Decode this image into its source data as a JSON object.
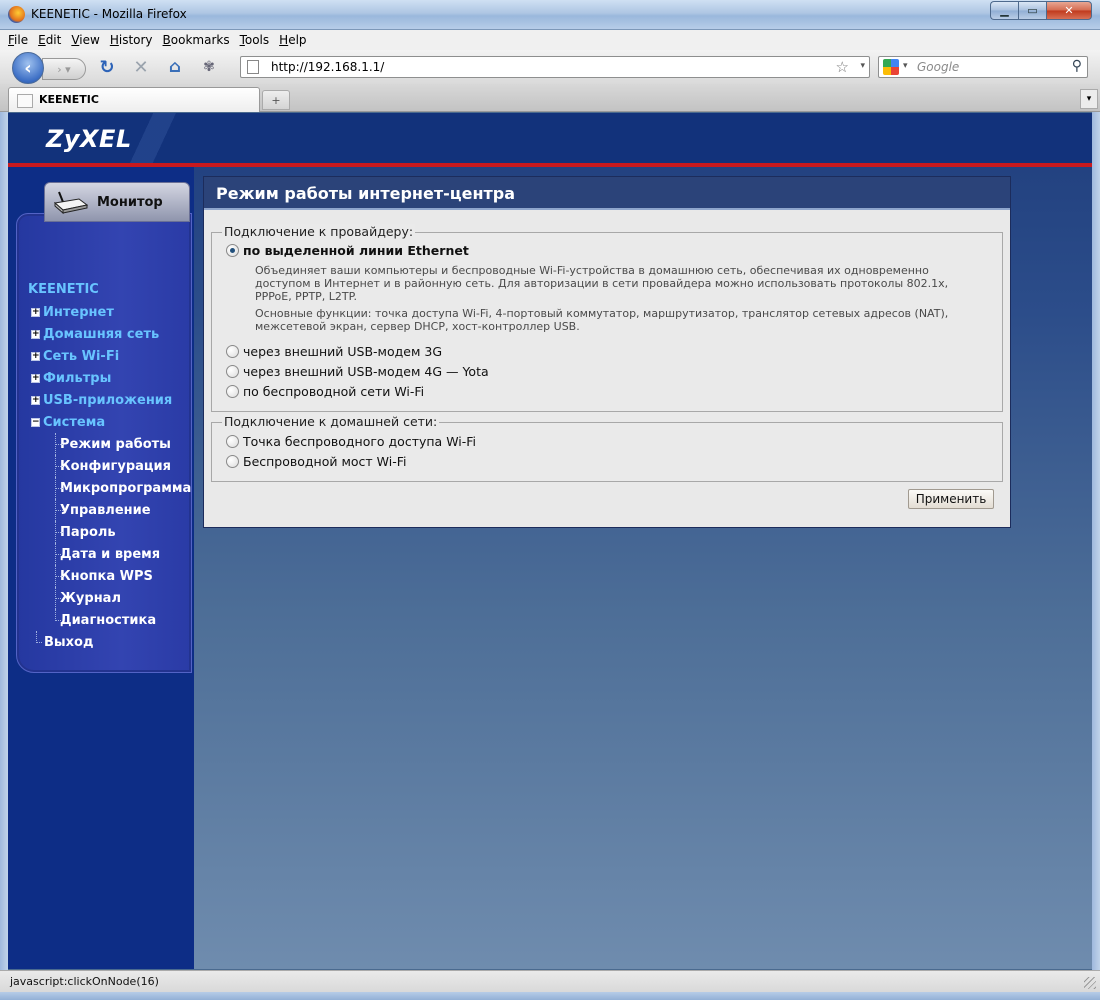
{
  "window": {
    "title": "KEENETIC - Mozilla Firefox"
  },
  "menubar": {
    "items": [
      "File",
      "Edit",
      "View",
      "History",
      "Bookmarks",
      "Tools",
      "Help"
    ]
  },
  "navbar": {
    "url": "http://192.168.1.1/",
    "search_placeholder": "Google"
  },
  "tabs": [
    {
      "label": "KEENETIC"
    }
  ],
  "page": {
    "brand": "ZyXEL",
    "monitor_tab": "Монитор",
    "tree_root": "KEENETIC",
    "tree": [
      {
        "label": "Интернет",
        "expanded": false
      },
      {
        "label": "Домашняя сеть",
        "expanded": false
      },
      {
        "label": "Сеть Wi-Fi",
        "expanded": false
      },
      {
        "label": "Фильтры",
        "expanded": false
      },
      {
        "label": "USB-приложения",
        "expanded": false
      },
      {
        "label": "Система",
        "expanded": true
      }
    ],
    "system_children": [
      "Режим работы",
      "Конфигурация",
      "Микропрограмма",
      "Управление",
      "Пароль",
      "Дата и время",
      "Кнопка WPS",
      "Журнал",
      "Диагностика"
    ],
    "exit": "Выход",
    "panel_title": "Режим работы интернет-центра",
    "provider_group": {
      "title": "Подключение к провайдеру:",
      "options": [
        {
          "label": "по выделенной линии Ethernet",
          "checked": true,
          "bold": true
        },
        {
          "label": "через внешний USB-модем 3G",
          "checked": false
        },
        {
          "label": "через внешний USB-модем 4G — Yota",
          "checked": false
        },
        {
          "label": "по беспроводной сети Wi-Fi",
          "checked": false
        }
      ],
      "desc1_line1": "Объединяет ваши компьютеры и беспроводные Wi-Fi-устройства в домашнюю сеть, обеспечивая их одновременно",
      "desc1_line2": "доступом в Интернет и в районную сеть. Для авторизации в сети провайдера можно использовать протоколы 802.1x,",
      "desc1_line3": "PPPoE, PPTP, L2TP.",
      "desc2_line1": "Основные функции: точка доступа Wi-Fi, 4-портовый коммутатор, маршрутизатор, транслятор сетевых адресов (NAT),",
      "desc2_line2": "межсетевой экран, сервер DHCP, хост-контроллер USB."
    },
    "home_group": {
      "title": "Подключение к домашней сети:",
      "options": [
        {
          "label": "Точка беспроводного доступа Wi-Fi",
          "checked": false
        },
        {
          "label": "Беспроводной мост Wi-Fi",
          "checked": false
        }
      ]
    },
    "apply_label": "Применить"
  },
  "status": {
    "text": "javascript:clickOnNode(16)"
  }
}
